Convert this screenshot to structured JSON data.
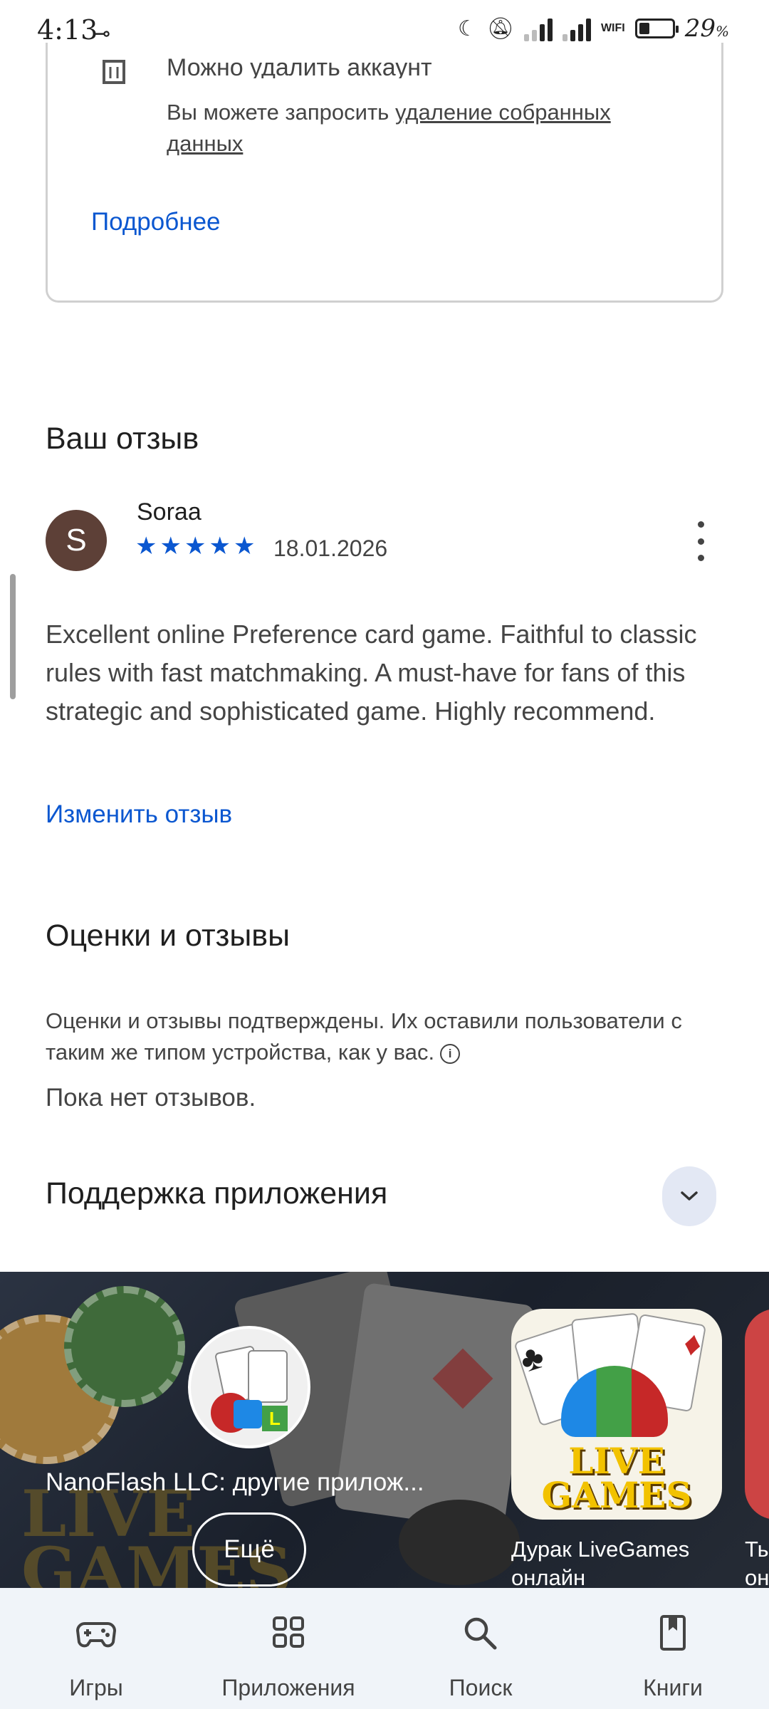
{
  "status_bar": {
    "time": "4:13",
    "battery": "29",
    "battery_unit": "%",
    "network_label": "WIFI"
  },
  "data_safety": {
    "item_title": "Можно удалить аккаунт",
    "item_text_prefix": "Вы можете запросить ",
    "item_text_link": "удаление собранных данных",
    "details_link": "Подробнее"
  },
  "your_review": {
    "title": "Ваш отзыв",
    "avatar_letter": "S",
    "reviewer": "Soraa",
    "rating": 5,
    "date": "18.01.2026",
    "body": "Excellent online Preference card game. Faithful to classic rules with fast matchmaking. A must-have for fans of this strategic and sophisticated game. Highly recommend.",
    "edit_link": "Изменить отзыв"
  },
  "ratings": {
    "title": "Оценки и отзывы",
    "note": "Оценки и отзывы подтверждены. Их оставили пользователи с таким же типом устройства, как у вас.",
    "empty": "Пока нет отзывов."
  },
  "support": {
    "title": "Поддержка приложения"
  },
  "developer_banner": {
    "name": "NanoFlash LLC: другие прилож...",
    "more_button": "Ещё",
    "apps": [
      {
        "name": "Дурак LiveGames онлайн",
        "logo_text": "LIVE GAMES"
      },
      {
        "name": "Ты он"
      }
    ]
  },
  "bottom_nav": {
    "items": [
      {
        "label": "Игры",
        "icon": "gamepad-icon"
      },
      {
        "label": "Приложения",
        "icon": "apps-grid-icon"
      },
      {
        "label": "Поиск",
        "icon": "search-icon"
      },
      {
        "label": "Книги",
        "icon": "book-icon"
      }
    ]
  },
  "colors": {
    "accent": "#0b57d0",
    "avatar": "#5d4037",
    "nav_bg": "#f0f4f9"
  }
}
